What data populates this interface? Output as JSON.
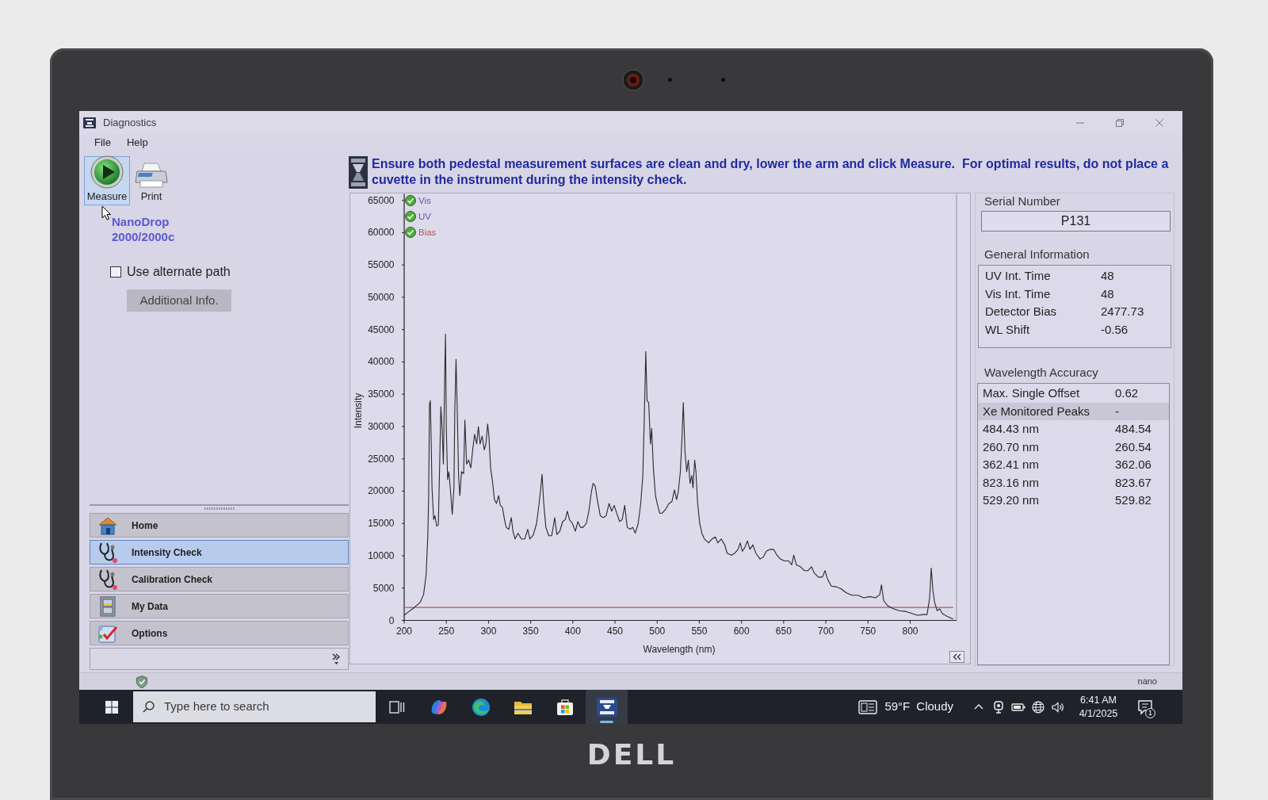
{
  "laptop": {
    "logo": "DELL"
  },
  "window": {
    "title": "Diagnostics"
  },
  "menu": [
    "File",
    "Help"
  ],
  "toolbar": [
    {
      "label": "Measure",
      "highlighted": true
    },
    {
      "label": "Print",
      "highlighted": false
    }
  ],
  "product_label": "NanoDrop 2000/2000c",
  "alternate_path": {
    "label": "Use alternate path",
    "checked": false
  },
  "additional_info_button": "Additional Info.",
  "nav": [
    {
      "label": "Home",
      "selected": false
    },
    {
      "label": "Intensity Check",
      "selected": true
    },
    {
      "label": "Calibration Check",
      "selected": false
    },
    {
      "label": "My Data",
      "selected": false
    },
    {
      "label": "Options",
      "selected": false
    }
  ],
  "instruction": "Ensure both pedestal measurement surfaces are clean and dry, lower the arm and click Measure.  For optimal results, do not place a cuvette in the instrument during the intensity check.",
  "chart": {
    "legend": [
      {
        "label": "Vis",
        "checked": true,
        "color": "#5561a8"
      },
      {
        "label": "UV",
        "checked": true,
        "color": "#5561a8"
      },
      {
        "label": "Bias",
        "checked": true,
        "color": "#b4584c"
      }
    ],
    "chart_data": {
      "type": "line",
      "xlabel": "Wavelength (nm)",
      "ylabel": "Intensity",
      "x": [
        200,
        205,
        212,
        219,
        223,
        226,
        228,
        229,
        230,
        231,
        232,
        233,
        235,
        236.5,
        238.5,
        240.5,
        242,
        243.5,
        245,
        246.5,
        248,
        249,
        250,
        251.5,
        253,
        255,
        257,
        259,
        260,
        261.5,
        263,
        264.5,
        266,
        268,
        270.5,
        272,
        274,
        276.5,
        279,
        281,
        283.5,
        286,
        288,
        290,
        292.5,
        295,
        297,
        299,
        300.5,
        302.5,
        305,
        307,
        309.5,
        312,
        314,
        316.5,
        319,
        321,
        324,
        327,
        329,
        331.5,
        335,
        339,
        343,
        346.5,
        349,
        353,
        357,
        360,
        361.5,
        363.5,
        365.5,
        368,
        371.5,
        375,
        378.5,
        381,
        384.5,
        388,
        391,
        393.5,
        396,
        399.5,
        403,
        406,
        409,
        412,
        416,
        419,
        422,
        424,
        426.5,
        429,
        432.5,
        436,
        439.5,
        443,
        446,
        449,
        452,
        455.5,
        458.5,
        461.5,
        464.5,
        468,
        471,
        474,
        477.5,
        480.5,
        483,
        485,
        486.5,
        488,
        490,
        492,
        493.5,
        495.5,
        498,
        500,
        503,
        506,
        510,
        514,
        517.5,
        520.5,
        523,
        525,
        527.5,
        529.5,
        531,
        533,
        535,
        537,
        539,
        541,
        542.5,
        544.5,
        546,
        548,
        550.5,
        553,
        556,
        561,
        565,
        569,
        572,
        576,
        580,
        583,
        588,
        592,
        596,
        598.5,
        601,
        604,
        607,
        610,
        613.5,
        617,
        622,
        626,
        629.5,
        634,
        638,
        642,
        646,
        651,
        656,
        659.5,
        662,
        665,
        670,
        674.5,
        679,
        683,
        686,
        691,
        696,
        699,
        702,
        706.5,
        712,
        718,
        724,
        731,
        738,
        745,
        752,
        759,
        764,
        766,
        768.5,
        773,
        780,
        787,
        794,
        801.5,
        808.5,
        815.5,
        820,
        823,
        825,
        827,
        829,
        832,
        835,
        838,
        844,
        851
      ],
      "series": [
        {
          "color": "#2a2a2a",
          "values": [
            800,
            1300,
            2000,
            2800,
            4000,
            7000,
            13000,
            19000,
            33400,
            34000,
            28000,
            20500,
            15600,
            16200,
            14600,
            14800,
            23600,
            33100,
            29700,
            24200,
            37700,
            44300,
            29700,
            21800,
            23000,
            19900,
            16400,
            20500,
            32200,
            40400,
            32200,
            22400,
            19300,
            23000,
            22700,
            31000,
            24200,
            24800,
            23600,
            26100,
            28800,
            27300,
            30000,
            27300,
            28500,
            26400,
            27300,
            30400,
            28500,
            23600,
            21200,
            18700,
            18100,
            19300,
            17800,
            17500,
            15600,
            14400,
            14100,
            15900,
            13800,
            12600,
            13500,
            12600,
            12600,
            14100,
            12600,
            13200,
            15000,
            18100,
            19900,
            22600,
            18100,
            14400,
            13100,
            13100,
            15900,
            13300,
            13800,
            15300,
            15600,
            16900,
            15600,
            15000,
            13800,
            15300,
            14400,
            14400,
            15000,
            16900,
            19900,
            21200,
            20800,
            18700,
            16200,
            15900,
            16200,
            18100,
            16900,
            17800,
            16600,
            15300,
            15600,
            17800,
            14400,
            14100,
            14400,
            13500,
            15000,
            18100,
            22400,
            32800,
            41600,
            34000,
            33700,
            27300,
            29700,
            23600,
            19300,
            18100,
            16600,
            16600,
            17200,
            18100,
            18400,
            20200,
            18700,
            19900,
            23000,
            28500,
            33700,
            26100,
            23000,
            24800,
            21200,
            22400,
            20500,
            24800,
            23000,
            18100,
            15000,
            13500,
            12600,
            12000,
            12600,
            12900,
            12000,
            12600,
            11700,
            10400,
            10100,
            10400,
            11000,
            12000,
            10700,
            11300,
            12300,
            11000,
            11700,
            10400,
            9500,
            9800,
            10700,
            11000,
            11000,
            10100,
            9500,
            9200,
            9200,
            8600,
            10100,
            8600,
            8300,
            7700,
            7700,
            8300,
            7400,
            6700,
            6700,
            7700,
            6400,
            5300,
            5200,
            4900,
            4300,
            3900,
            3900,
            3500,
            3700,
            3500,
            4000,
            5500,
            3100,
            2300,
            1800,
            1500,
            1400,
            1100,
            800,
            900,
            900,
            3400,
            8100,
            4600,
            2800,
            1500,
            1800,
            1100,
            600,
            200
          ]
        },
        {
          "color": "#b4584c",
          "values": [
            2000,
            2000,
            2000,
            2000,
            2000,
            2000,
            2000,
            2000,
            2000,
            2000,
            2000,
            2000,
            2000,
            2000,
            2000,
            2000,
            2000,
            2000,
            2000,
            2000,
            2000,
            2000,
            2000,
            2000,
            2000,
            2000,
            2000,
            2000,
            2000,
            2000,
            2000,
            2000,
            2000,
            2000,
            2000,
            2000,
            2000,
            2000,
            2000,
            2000,
            2000,
            2000,
            2000,
            2000,
            2000,
            2000,
            2000,
            2000,
            2000,
            2000,
            2000,
            2000,
            2000,
            2000,
            2000,
            2000,
            2000,
            2000,
            2000,
            2000,
            2000,
            2000,
            2000,
            2000,
            2000,
            2000,
            2000,
            2000,
            2000,
            2000,
            2000,
            2000,
            2000,
            2000,
            2000,
            2000,
            2000,
            2000,
            2000,
            2000,
            2000,
            2000,
            2000,
            2000,
            2000,
            2000,
            2000,
            2000,
            2000,
            2000,
            2000,
            2000,
            2000,
            2000,
            2000,
            2000,
            2000,
            2000,
            2000,
            2000,
            2000,
            2000,
            2000,
            2000,
            2000,
            2000,
            2000,
            2000,
            2000,
            2000,
            2000,
            2000,
            2000,
            2000,
            2000,
            2000,
            2000,
            2000,
            2000,
            2000,
            2000,
            2000,
            2000,
            2000,
            2000,
            2000,
            2000,
            2000,
            2000,
            2000,
            2000,
            2000,
            2000,
            2000,
            2000,
            2000,
            2000,
            2000,
            2000,
            2000,
            2000,
            2000,
            2000,
            2000,
            2000,
            2000,
            2000,
            2000,
            2000,
            2000,
            2000,
            2000,
            2000,
            2000,
            2000,
            2000,
            2000,
            2000,
            2000,
            2000,
            2000,
            2000,
            2000,
            2000,
            2000,
            2000,
            2000,
            2000,
            2000,
            2000,
            2000,
            2000,
            2000,
            2000,
            2000,
            2000,
            2000,
            2000,
            2000,
            2000,
            2000,
            2000,
            2000,
            2000,
            2000,
            2000,
            2000,
            2000,
            2000,
            2000,
            2000,
            2000,
            2000,
            2000,
            2000,
            2000,
            2000,
            2000,
            2000,
            2000,
            2000,
            2000,
            2000,
            2000,
            2000,
            2000,
            2000,
            2000,
            2000,
            2000
          ]
        }
      ],
      "xlim": [
        200,
        855
      ],
      "ylim": [
        0,
        66000
      ],
      "xticks": [
        200,
        250,
        300,
        350,
        400,
        450,
        500,
        550,
        600,
        650,
        700,
        750,
        800
      ],
      "yticks": [
        0,
        5000,
        10000,
        15000,
        20000,
        25000,
        30000,
        35000,
        40000,
        45000,
        50000,
        55000,
        60000,
        65000
      ]
    }
  },
  "serial_number": {
    "label": "Serial Number",
    "value": "P131"
  },
  "general_information": {
    "title": "General Information",
    "rows": [
      {
        "label": "UV Int. Time",
        "value": "48"
      },
      {
        "label": "Vis Int. Time",
        "value": "48"
      },
      {
        "label": "Detector Bias",
        "value": "2477.73"
      },
      {
        "label": "WL Shift",
        "value": "-0.56"
      }
    ]
  },
  "wavelength_accuracy": {
    "title": "Wavelength Accuracy",
    "rows": [
      {
        "kind": "row",
        "label": "Max. Single Offset",
        "value": "0.62"
      },
      {
        "kind": "section",
        "label": "Xe Monitored Peaks",
        "value": "-"
      },
      {
        "kind": "row",
        "label": "484.43 nm",
        "value": "484.54"
      },
      {
        "kind": "row",
        "label": "260.70 nm",
        "value": "260.54"
      },
      {
        "kind": "row",
        "label": "362.41 nm",
        "value": "362.06"
      },
      {
        "kind": "row",
        "label": "823.16 nm",
        "value": "823.67"
      },
      {
        "kind": "row",
        "label": "529.20 nm",
        "value": "529.82"
      }
    ]
  },
  "status_bar": {
    "text": "nano"
  },
  "taskbar": {
    "search_placeholder": "Type here to search",
    "apps": [
      {
        "active": false
      },
      {
        "active": false
      },
      {
        "active": false
      },
      {
        "active": false
      },
      {
        "active": false
      },
      {
        "active": true
      }
    ],
    "weather": {
      "temperature": "59°F",
      "condition": "Cloudy"
    },
    "clock": {
      "time": "6:41 AM",
      "date": "4/1/2025"
    },
    "notification_count": "1"
  }
}
